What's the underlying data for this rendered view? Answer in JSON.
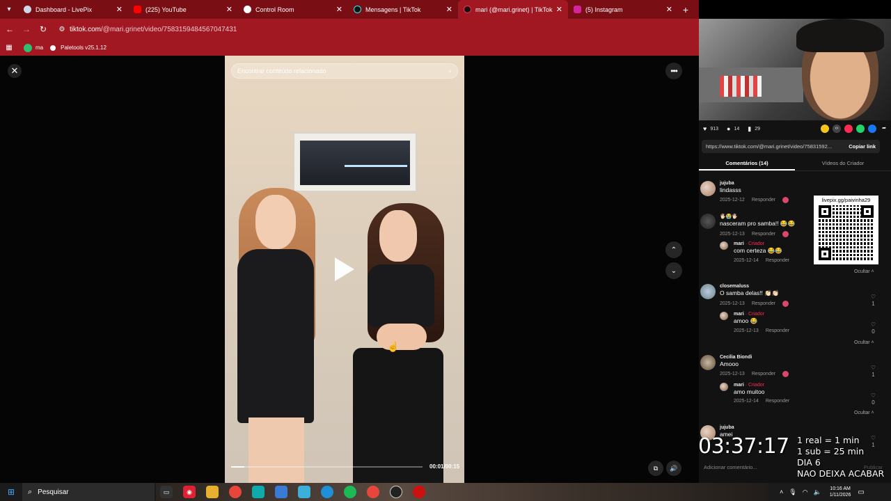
{
  "browser": {
    "tabs": [
      {
        "label": "Dashboard - LivePix",
        "color": "#cfd8e6"
      },
      {
        "label": "(225) YouTube",
        "color": "#ff0000"
      },
      {
        "label": "Control Room",
        "color": "#ffffff"
      },
      {
        "label": "Mensagens | TikTok",
        "color": "#111111"
      },
      {
        "label": "mari (@mari.grinet) | TikTok",
        "color": "#111111"
      },
      {
        "label": "(5) Instagram",
        "color": "#d6249f"
      }
    ],
    "url_host": "tiktok.com",
    "url_path": "/@mari.grinet/video/7583159484567047431",
    "bookmarks": [
      {
        "label": "ma",
        "color": "#2fbf71"
      },
      {
        "label": "Paletools v25.1.12",
        "color": "#ffffff"
      }
    ]
  },
  "video": {
    "search_placeholder": "Encontrar conteúdo relacionado",
    "timecode": "00:01/00:15",
    "progress": 0.07
  },
  "stats": {
    "likes": "913",
    "comments": "14",
    "saves": "29"
  },
  "link": {
    "url": "https://www.tiktok.com/@mari.grinet/video/75831592...",
    "copy_label": "Copiar link"
  },
  "tabs": {
    "comments": "Comentários (14)",
    "creator_videos": "Vídeos do Criador"
  },
  "comments": [
    {
      "name": "jujuba",
      "text": "lindasss",
      "date": "2025-12-12",
      "reply": "Responder"
    },
    {
      "name": "🖐🏻😭🖐🏻",
      "text": "nasceram pro samba!! 😂😂",
      "date": "2025-12-13",
      "reply": "Responder",
      "sub": {
        "name": "mari",
        "tag": "· Criador",
        "text": "com certeza 😂😂",
        "date": "2025-12-14",
        "reply": "Responder"
      }
    },
    {
      "name": "closemaluss",
      "text": "O samba delas!! 👏🏻👏🏻",
      "date": "2025-12-13",
      "reply": "Responder",
      "likes": "1",
      "sub": {
        "name": "mari",
        "tag": "· Criador",
        "text": "amoo 😂",
        "date": "2025-12-13",
        "reply": "Responder",
        "likes": "0"
      }
    },
    {
      "name": "Cecilia Biondi",
      "text": "Amooo",
      "date": "2025-12-13",
      "reply": "Responder",
      "likes": "1",
      "sub": {
        "name": "mari",
        "tag": "· Criador",
        "text": "amo muitoo",
        "date": "2025-12-14",
        "reply": "Responder",
        "likes": "0"
      }
    },
    {
      "name": "jujuba",
      "text": "amei",
      "likes": "1"
    }
  ],
  "hide_label": "Ocultar",
  "qr_label": "livepix.gg/paivinha29",
  "comment_input": {
    "placeholder": "Adicionar comentário...",
    "publish": "Publicar"
  },
  "overlay": {
    "timer": "03:37:17",
    "lines": [
      "1 real = 1 min",
      "1 sub = 25 min",
      "DIA 6",
      "NAO DEIXA ACABAR"
    ]
  },
  "taskbar": {
    "search": "Pesquisar",
    "time": "10:16 AM",
    "date": "1/11/2026"
  }
}
